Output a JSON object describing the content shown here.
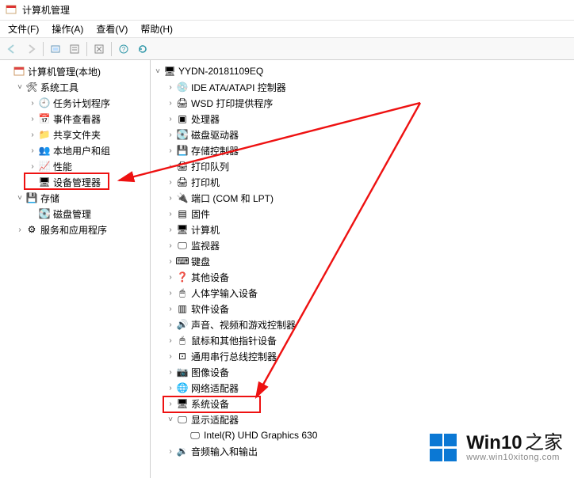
{
  "window": {
    "title": "计算机管理"
  },
  "menu": {
    "file": "文件(F)",
    "action": "操作(A)",
    "view": "查看(V)",
    "help": "帮助(H)"
  },
  "toolbar_icons": [
    "back",
    "forward",
    "up",
    "props",
    "delete",
    "help",
    "refresh"
  ],
  "left_tree": {
    "root": {
      "label": "计算机管理(本地)"
    },
    "sys_tools": {
      "label": "系统工具"
    },
    "sys_children": [
      {
        "key": "task-scheduler",
        "label": "任务计划程序",
        "icon": "clock"
      },
      {
        "key": "event-viewer",
        "label": "事件查看器",
        "icon": "event"
      },
      {
        "key": "shared-folders",
        "label": "共享文件夹",
        "icon": "share"
      },
      {
        "key": "local-users",
        "label": "本地用户和组",
        "icon": "users"
      },
      {
        "key": "performance",
        "label": "性能",
        "icon": "perf"
      }
    ],
    "device_mgr": {
      "label": "设备管理器"
    },
    "storage": {
      "label": "存储"
    },
    "disk_mgmt": {
      "label": "磁盘管理"
    },
    "services": {
      "label": "服务和应用程序"
    }
  },
  "right_tree": {
    "root": {
      "label": "YYDN-20181109EQ"
    },
    "categories": [
      {
        "key": "ide",
        "label": "IDE ATA/ATAPI 控制器"
      },
      {
        "key": "wsd",
        "label": "WSD 打印提供程序"
      },
      {
        "key": "cpu",
        "label": "处理器"
      },
      {
        "key": "disk",
        "label": "磁盘驱动器"
      },
      {
        "key": "storctrl",
        "label": "存储控制器"
      },
      {
        "key": "printq",
        "label": "打印队列"
      },
      {
        "key": "printer",
        "label": "打印机"
      },
      {
        "key": "ports",
        "label": "端口 (COM 和 LPT)"
      },
      {
        "key": "firmware",
        "label": "固件"
      },
      {
        "key": "computer",
        "label": "计算机"
      },
      {
        "key": "monitor",
        "label": "监视器"
      },
      {
        "key": "keyboard",
        "label": "键盘"
      },
      {
        "key": "other",
        "label": "其他设备"
      },
      {
        "key": "hid",
        "label": "人体学输入设备"
      },
      {
        "key": "software",
        "label": "软件设备"
      },
      {
        "key": "audiovideo",
        "label": "声音、视频和游戏控制器"
      },
      {
        "key": "mouse",
        "label": "鼠标和其他指针设备"
      },
      {
        "key": "usb",
        "label": "通用串行总线控制器"
      },
      {
        "key": "imaging",
        "label": "图像设备"
      },
      {
        "key": "net",
        "label": "网络适配器"
      },
      {
        "key": "sysdev",
        "label": "系统设备"
      }
    ],
    "display": {
      "label": "显示适配器",
      "children": [
        {
          "label": "Intel(R) UHD Graphics 630"
        }
      ]
    },
    "audioio": {
      "label": "音频输入和输出"
    }
  },
  "watermark": {
    "brand": "Win10",
    "suffix": "之家",
    "url": "www.win10xitong.com"
  },
  "icons": {
    "clock": "🕘",
    "event": "📅",
    "share": "📁",
    "users": "👥",
    "perf": "📈",
    "device": "🖥",
    "storage": "💾",
    "disk": "💽",
    "services": "⚙",
    "pc": "🖥",
    "ide": "💿",
    "wsd": "🖨",
    "cpu": "▣",
    "diskdrv": "💽",
    "storctrl": "💾",
    "printq": "🖨",
    "printer": "🖨",
    "ports": "🔌",
    "firmware": "▤",
    "computer": "🖥",
    "monitor": "🖵",
    "keyboard": "⌨",
    "other": "❓",
    "hid": "🖱",
    "software": "▥",
    "audiovideo": "🔊",
    "mouse": "🖱",
    "usb": "⊡",
    "imaging": "📷",
    "net": "🌐",
    "sysdev": "🖥",
    "display": "🖵",
    "gpu": "🖵",
    "audioio": "🔉"
  }
}
